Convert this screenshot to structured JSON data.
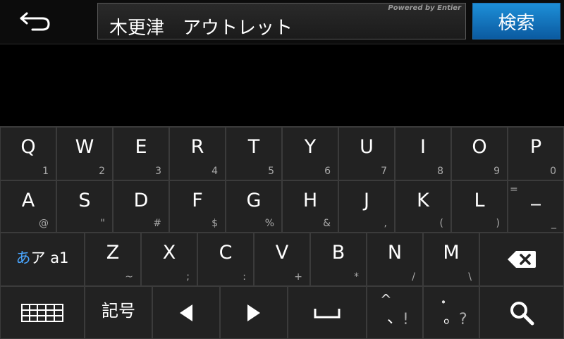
{
  "topbar": {
    "back_icon": "back-arrow-icon",
    "search_value": "木更津　アウトレット",
    "powered_by": "Powered by Entier",
    "search_button_label": "検索",
    "accent_color": "#1480cc"
  },
  "keyboard": {
    "row1": [
      {
        "main": "Q",
        "sub": "1"
      },
      {
        "main": "W",
        "sub": "2"
      },
      {
        "main": "E",
        "sub": "3"
      },
      {
        "main": "R",
        "sub": "4"
      },
      {
        "main": "T",
        "sub": "5"
      },
      {
        "main": "Y",
        "sub": "6"
      },
      {
        "main": "U",
        "sub": "7"
      },
      {
        "main": "I",
        "sub": "8"
      },
      {
        "main": "O",
        "sub": "9"
      },
      {
        "main": "P",
        "sub": "0"
      }
    ],
    "row2": [
      {
        "main": "A",
        "sub": "@"
      },
      {
        "main": "S",
        "sub": "\""
      },
      {
        "main": "D",
        "sub": "#"
      },
      {
        "main": "F",
        "sub": "$"
      },
      {
        "main": "G",
        "sub": "%"
      },
      {
        "main": "H",
        "sub": "&"
      },
      {
        "main": "J",
        "sub": ","
      },
      {
        "main": "K",
        "sub": "("
      },
      {
        "main": "L",
        "sub": ")"
      },
      {
        "main": "_",
        "sub": "=",
        "sub2": "_"
      }
    ],
    "mode_key": {
      "hira": "あ",
      "rest": "ア a1"
    },
    "row3": [
      {
        "main": "Z",
        "sub": "~"
      },
      {
        "main": "X",
        "sub": ";"
      },
      {
        "main": "C",
        "sub": ":"
      },
      {
        "main": "V",
        "sub": "+"
      },
      {
        "main": "B",
        "sub": "*"
      },
      {
        "main": "N",
        "sub": "/"
      },
      {
        "main": "M",
        "sub": "\\"
      }
    ],
    "backspace_icon": "backspace-icon",
    "grid_icon": "keyboard-grid-icon",
    "symbol_key_label": "記号",
    "left_icon": "left-arrow-icon",
    "right_icon": "right-arrow-icon",
    "space_icon": "space-icon",
    "punct_key_a": {
      "a": "^",
      "b": "、",
      "c": "!"
    },
    "punct_key_b": {
      "a": "・",
      "b": "。",
      "c": "?"
    },
    "search_icon": "search-icon"
  }
}
